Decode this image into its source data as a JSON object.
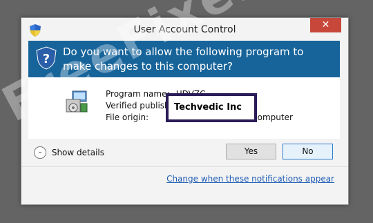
{
  "window": {
    "title": "User Account Control",
    "close_glyph": "✕"
  },
  "header": {
    "question": "Do you want to allow the following program to make changes to this computer?",
    "icon": "uac-shield-icon"
  },
  "program": {
    "icon": "installer-icon",
    "rows": [
      {
        "label": "Program name:",
        "value": "UDVZC"
      },
      {
        "label": "Verified publisher:",
        "value": ""
      },
      {
        "label": "File origin:",
        "value": "Hard drive on this computer"
      }
    ],
    "publisher": "Techvedic Inc"
  },
  "details": {
    "label": "Show details",
    "icon": "chevron-down-icon"
  },
  "buttons": {
    "yes": "Yes",
    "no": "No"
  },
  "link": "Change when these notifications appear",
  "watermark": "FreeFixer.com",
  "colors": {
    "header_bg": "#17649a",
    "close_bg": "#c7483a",
    "publisher_border": "#2b1b57",
    "link": "#1f5db5"
  }
}
